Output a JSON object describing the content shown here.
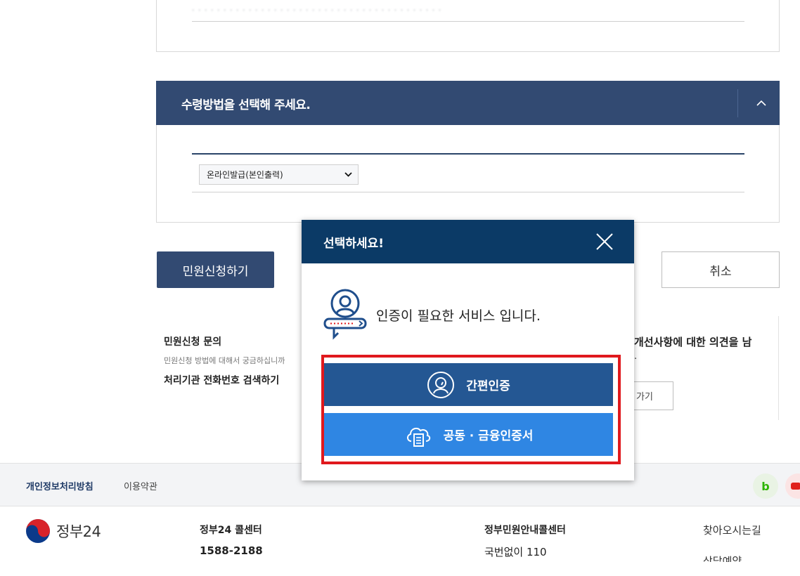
{
  "top_card": {
    "partial_text": "· · · ·  ·  ·  · · · · · · ·  ·  ·  ·  ·   ·  ·  ·  · · · · · ·  · · · · · · ·  · · ·  ·  ·  ·  ·"
  },
  "receive_section": {
    "title": "수령방법을 선택해 주세요.",
    "toggle": "︿",
    "select_value": "온라인발급(본인출력)"
  },
  "actions": {
    "apply_label": "민원신청하기",
    "cancel_label": "취소"
  },
  "inquiry": {
    "title": "민원신청 문의",
    "description": "민원신청 방법에 대해서 궁금하십니까",
    "link": "처리기관 전화번호 검색하기"
  },
  "feedback": {
    "text1": "개선사항에 대한 의견을 남",
    "text2": ".",
    "button": "가기"
  },
  "modal": {
    "title": "선택하세요!",
    "info_text": "인증이 필요한 서비스 입니다.",
    "simple_auth_label": "간편인증",
    "cert_auth_label": "공동 · 금융인증서"
  },
  "footer": {
    "privacy": "개인정보처리방침",
    "terms": "이용약관",
    "blog_icon": "b",
    "logo_text": "정부24",
    "col1_title": "정부24 콜센터",
    "col1_number": "1588-2188",
    "col2_title": "정부민원안내콜센터",
    "col2_number": "국번없이 110",
    "col3_title": "찾아오시는길",
    "col3_next": "상담예약"
  },
  "colors": {
    "primary": "#324a72",
    "modal_header": "#0b3a66",
    "simple_btn": "#245793",
    "cert_btn": "#2f86e3",
    "highlight": "#e0191d"
  }
}
